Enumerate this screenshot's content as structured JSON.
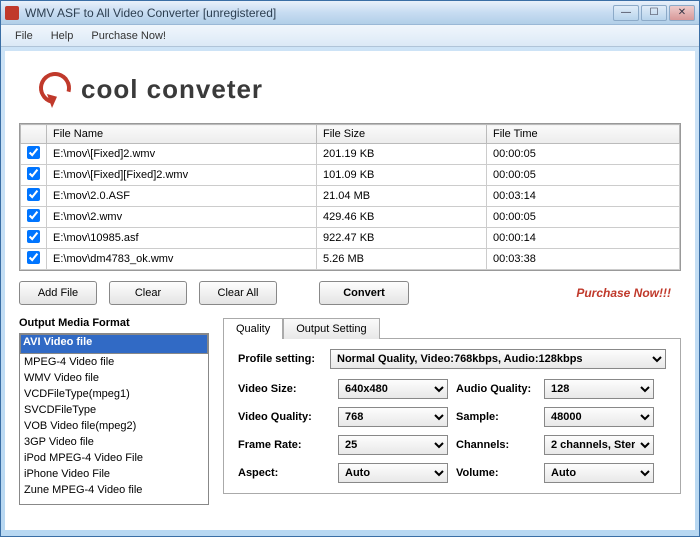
{
  "window": {
    "title": "WMV ASF to All Video Converter  [unregistered]"
  },
  "menu": {
    "file": "File",
    "help": "Help",
    "purchase": "Purchase Now!"
  },
  "logo": {
    "text": "cool conveter"
  },
  "table": {
    "headers": {
      "name": "File Name",
      "size": "File Size",
      "time": "File Time"
    },
    "rows": [
      {
        "name": "E:\\mov\\[Fixed]2.wmv",
        "size": "201.19 KB",
        "time": "00:00:05"
      },
      {
        "name": "E:\\mov\\[Fixed][Fixed]2.wmv",
        "size": "101.09 KB",
        "time": "00:00:05"
      },
      {
        "name": "E:\\mov\\2.0.ASF",
        "size": "21.04 MB",
        "time": "00:03:14"
      },
      {
        "name": "E:\\mov\\2.wmv",
        "size": "429.46 KB",
        "time": "00:00:05"
      },
      {
        "name": "E:\\mov\\10985.asf",
        "size": "922.47 KB",
        "time": "00:00:14"
      },
      {
        "name": "E:\\mov\\dm4783_ok.wmv",
        "size": "5.26 MB",
        "time": "00:03:38"
      }
    ]
  },
  "buttons": {
    "addfile": "Add File",
    "clear": "Clear",
    "clearall": "Clear All",
    "convert": "Convert",
    "purchase": "Purchase Now!!!"
  },
  "format": {
    "label": "Output Media Format",
    "items": [
      "AVI Video file",
      "MPEG-4 Video file",
      "WMV Video file",
      "VCDFileType(mpeg1)",
      "SVCDFileType",
      "VOB Video file(mpeg2)",
      "3GP Video file",
      "iPod MPEG-4 Video File",
      "iPhone Video File",
      "Zune MPEG-4 Video file"
    ]
  },
  "tabs": {
    "quality": "Quality",
    "output": "Output Setting"
  },
  "settings": {
    "profile_label": "Profile setting:",
    "profile_value": "Normal Quality, Video:768kbps, Audio:128kbps",
    "videosize_label": "Video Size:",
    "videosize_value": "640x480",
    "videoquality_label": "Video Quality:",
    "videoquality_value": "768",
    "framerate_label": "Frame Rate:",
    "framerate_value": "25",
    "aspect_label": "Aspect:",
    "aspect_value": "Auto",
    "audioquality_label": "Audio Quality:",
    "audioquality_value": "128",
    "sample_label": "Sample:",
    "sample_value": "48000",
    "channels_label": "Channels:",
    "channels_value": "2 channels, Ster",
    "volume_label": "Volume:",
    "volume_value": "Auto"
  }
}
